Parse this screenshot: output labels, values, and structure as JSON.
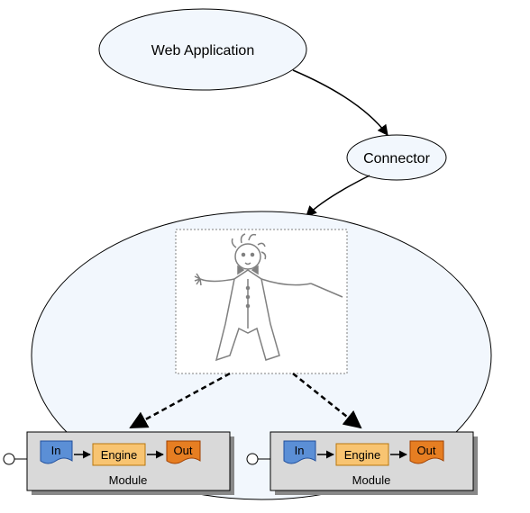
{
  "nodes": {
    "web_app": {
      "label": "Web Application"
    },
    "connector": {
      "label": "Connector"
    },
    "module_left": {
      "in": "In",
      "engine": "Engine",
      "out": "Out",
      "caption": "Module"
    },
    "module_right": {
      "in": "In",
      "engine": "Engine",
      "out": "Out",
      "caption": "Module"
    }
  },
  "colors": {
    "ellipse_fill": "#F2F7FD",
    "ellipse_stroke": "#000000",
    "module_fill": "#D9D9D9",
    "module_shadow": "#888888",
    "module_stroke": "#000000",
    "in_fill": "#5B8FD6",
    "in_stroke": "#1F4E9C",
    "engine_fill": "#F8C471",
    "engine_stroke": "#B9770E",
    "out_fill": "#E67E22",
    "out_stroke": "#A04000",
    "conductor_stroke": "#808080",
    "conductor_box_fill": "#ffffff"
  }
}
